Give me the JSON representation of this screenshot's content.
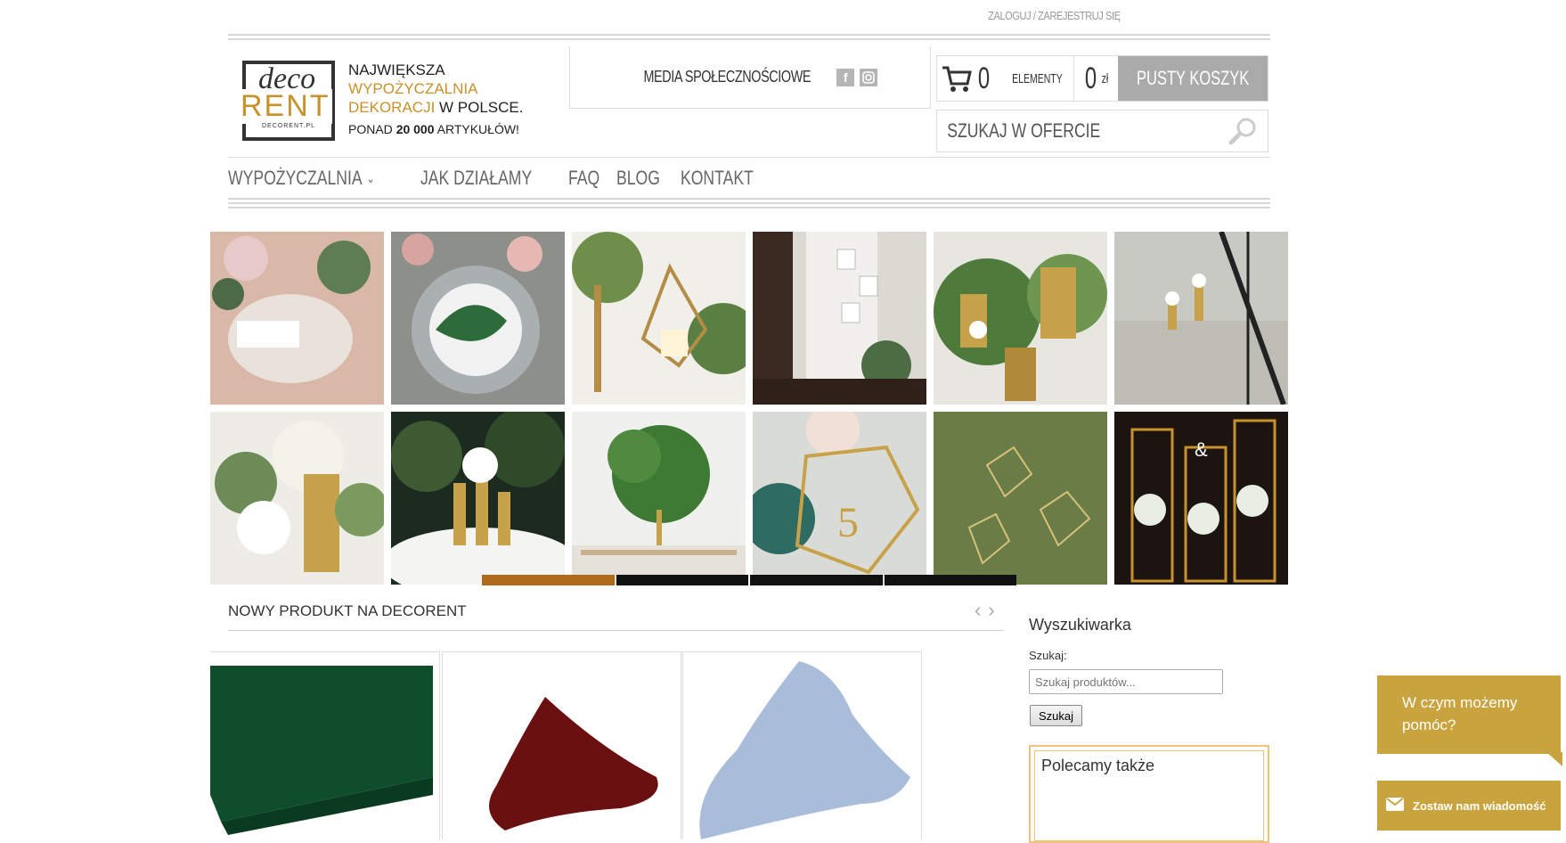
{
  "header": {
    "login_link": "ZALOGUJ / ZAREJESTRUJ SIĘ",
    "logo": {
      "deco": "deco",
      "rent": "RENT",
      "url": "DECORENT.PL"
    },
    "tagline": {
      "line1": "NAJWIĘKSZA",
      "line2": "WYPOŻYCZALNIA",
      "line3_gold": "DEKORACJI",
      "line3_rest": " W POLSCE.",
      "line4_pre": "PONAD ",
      "line4_bold": "20 000",
      "line4_post": " ARTYKUŁÓW!"
    },
    "social_label": "MEDIA SPOŁECZNOŚCIOWE",
    "social_icons": [
      "facebook-icon",
      "instagram-icon"
    ],
    "cart": {
      "count": "0",
      "count_label": "ELEMENTY",
      "sum": "0",
      "currency": "zł",
      "empty_button": "PUSTY KOSZYK"
    },
    "search_placeholder": "SZUKAJ W OFERCIE"
  },
  "nav": {
    "items": [
      "WYPOŻYCZALNIA",
      "JAK DZIAŁAMY",
      "FAQ",
      "BLOG",
      "KONTAKT"
    ]
  },
  "slider": {
    "segments": 4,
    "active_index": 0
  },
  "new_products": {
    "title": "NOWY PRODUKT NA DECORENT",
    "prev": "‹",
    "next": "›"
  },
  "sidebar": {
    "title": "Wyszukiwarka",
    "search_label": "Szukaj:",
    "search_placeholder": "Szukaj produktów...",
    "search_button": "Szukaj",
    "recommend_title": "Polecamy także"
  },
  "chat": {
    "help_text_1": "W czym możemy",
    "help_text_2": "pomóc?",
    "message_button": "Zostaw nam wiadomość"
  },
  "colors": {
    "gold": "#c8912a",
    "chat": "#c9a43e",
    "slider_active": "#b06a1c",
    "cart_button": "#aaaaaa"
  }
}
